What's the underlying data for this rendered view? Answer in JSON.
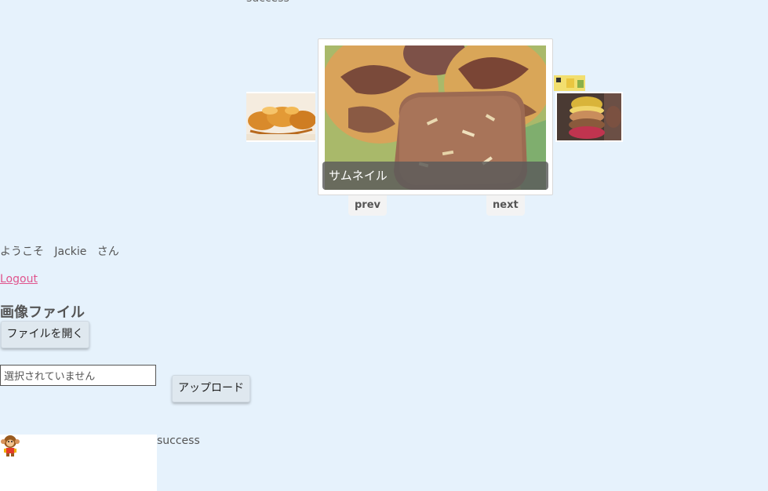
{
  "status_top": "success",
  "carousel": {
    "caption": "サムネイル",
    "prev_label": "prev",
    "next_label": "next"
  },
  "user": {
    "welcome_prefix": "ようこそ",
    "name": "Jackie",
    "suffix": "さん"
  },
  "logout_label": "Logout",
  "upload": {
    "section_title": "画像ファイル",
    "open_button_label": "ファイルを開く",
    "file_status": "選択されていません",
    "upload_button_label": "アップロード"
  },
  "result": {
    "status": "success"
  },
  "colors": {
    "background": "#e6f2fc",
    "link": "#e0558d",
    "button": "#dfe8ef"
  }
}
